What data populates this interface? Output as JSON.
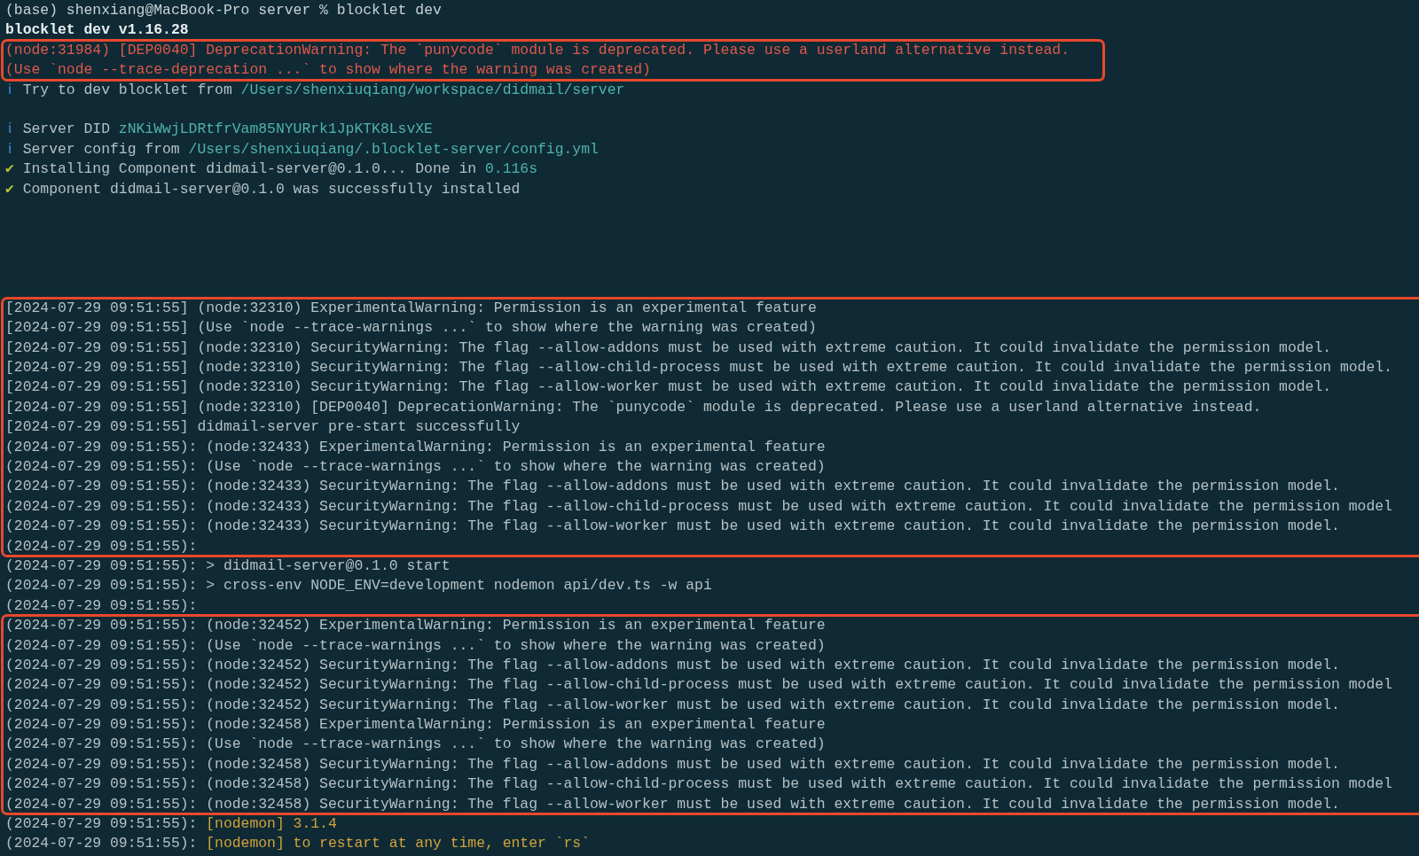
{
  "blocks": [
    {
      "highlighted": false,
      "lines": [
        {
          "kind": "text",
          "segments": [
            {
              "text": "(base) shenxiang@MacBook-Pro server % blocklet dev",
              "kind": "prompt"
            }
          ]
        },
        {
          "kind": "text",
          "segments": [
            {
              "text": "blocklet dev v1.16.28",
              "kind": "bold"
            }
          ]
        }
      ]
    },
    {
      "highlighted": true,
      "lines": [
        {
          "kind": "text",
          "segments": [
            {
              "text": "(node:31984) [DEP0040] DeprecationWarning: The `punycode` module is deprecated. Please use a userland alternative instead.",
              "kind": "error"
            }
          ]
        },
        {
          "kind": "text",
          "segments": [
            {
              "text": "(Use `node --trace-deprecation ...` to show where the warning was created)",
              "kind": "error"
            }
          ]
        }
      ]
    },
    {
      "highlighted": false,
      "lines": [
        {
          "kind": "text",
          "icon": {
            "kind": "info",
            "text": "ℹ"
          },
          "segments": [
            {
              "text": "Try to dev blocklet from ",
              "kind": "plain"
            },
            {
              "text": "/Users/shenxiuqiang/workspace/didmail/server",
              "kind": "accent"
            }
          ]
        },
        {
          "kind": "blank"
        },
        {
          "kind": "text",
          "icon": {
            "kind": "info",
            "text": "ℹ"
          },
          "segments": [
            {
              "text": "Server DID ",
              "kind": "plain"
            },
            {
              "text": "zNKiWwjLDRtfrVam85NYURrk1JpKTK8LsvXE",
              "kind": "accent"
            }
          ]
        },
        {
          "kind": "text",
          "icon": {
            "kind": "info",
            "text": "ℹ"
          },
          "segments": [
            {
              "text": "Server config from ",
              "kind": "plain"
            },
            {
              "text": "/Users/shenxiuqiang/.blocklet-server/config.yml",
              "kind": "accent"
            }
          ]
        },
        {
          "kind": "text",
          "icon": {
            "kind": "check",
            "text": "✔"
          },
          "segments": [
            {
              "text": "Installing Component didmail-server@0.1.0... Done in ",
              "kind": "plain"
            },
            {
              "text": "0.116s",
              "kind": "accent"
            }
          ]
        },
        {
          "kind": "text",
          "icon": {
            "kind": "check",
            "text": "✔"
          },
          "segments": [
            {
              "text": "Component didmail-server@0.1.0 was successfully installed",
              "kind": "plain"
            }
          ]
        },
        {
          "kind": "blank"
        },
        {
          "kind": "blank"
        },
        {
          "kind": "blank"
        },
        {
          "kind": "blank"
        },
        {
          "kind": "blank"
        }
      ]
    },
    {
      "highlighted": true,
      "lines": [
        {
          "kind": "text",
          "segments": [
            {
              "text": "[2024-07-29 09:51:55] (node:32310) ExperimentalWarning: Permission is an experimental feature",
              "kind": "plain"
            }
          ]
        },
        {
          "kind": "text",
          "segments": [
            {
              "text": "[2024-07-29 09:51:55] (Use `node --trace-warnings ...` to show where the warning was created)",
              "kind": "plain"
            }
          ]
        },
        {
          "kind": "text",
          "segments": [
            {
              "text": "[2024-07-29 09:51:55] (node:32310) SecurityWarning: The flag --allow-addons must be used with extreme caution. It could invalidate the permission model.",
              "kind": "plain"
            }
          ]
        },
        {
          "kind": "text",
          "segments": [
            {
              "text": "[2024-07-29 09:51:55] (node:32310) SecurityWarning: The flag --allow-child-process must be used with extreme caution. It could invalidate the permission model.",
              "kind": "plain"
            }
          ]
        },
        {
          "kind": "text",
          "segments": [
            {
              "text": "[2024-07-29 09:51:55] (node:32310) SecurityWarning: The flag --allow-worker must be used with extreme caution. It could invalidate the permission model.",
              "kind": "plain"
            }
          ]
        },
        {
          "kind": "text",
          "segments": [
            {
              "text": "[2024-07-29 09:51:55] (node:32310) [DEP0040] DeprecationWarning: The `punycode` module is deprecated. Please use a userland alternative instead.",
              "kind": "plain"
            }
          ]
        },
        {
          "kind": "text",
          "segments": [
            {
              "text": "[2024-07-29 09:51:55] didmail-server pre-start successfully",
              "kind": "plain"
            }
          ]
        },
        {
          "kind": "text",
          "segments": [
            {
              "text": "(2024-07-29 09:51:55): (node:32433) ExperimentalWarning: Permission is an experimental feature",
              "kind": "plain"
            }
          ]
        },
        {
          "kind": "text",
          "segments": [
            {
              "text": "(2024-07-29 09:51:55): (Use `node --trace-warnings ...` to show where the warning was created)",
              "kind": "plain"
            }
          ]
        },
        {
          "kind": "text",
          "segments": [
            {
              "text": "(2024-07-29 09:51:55): (node:32433) SecurityWarning: The flag --allow-addons must be used with extreme caution. It could invalidate the permission model.",
              "kind": "plain"
            }
          ]
        },
        {
          "kind": "text",
          "segments": [
            {
              "text": "(2024-07-29 09:51:55): (node:32433) SecurityWarning: The flag --allow-child-process must be used with extreme caution. It could invalidate the permission model",
              "kind": "plain"
            }
          ]
        },
        {
          "kind": "text",
          "segments": [
            {
              "text": "(2024-07-29 09:51:55): (node:32433) SecurityWarning: The flag --allow-worker must be used with extreme caution. It could invalidate the permission model.",
              "kind": "plain"
            }
          ]
        },
        {
          "kind": "text",
          "segments": [
            {
              "text": "(2024-07-29 09:51:55):",
              "kind": "plain"
            }
          ]
        }
      ]
    },
    {
      "highlighted": false,
      "lines": [
        {
          "kind": "text",
          "segments": [
            {
              "text": "(2024-07-29 09:51:55): > didmail-server@0.1.0 start",
              "kind": "plain"
            }
          ]
        },
        {
          "kind": "text",
          "segments": [
            {
              "text": "(2024-07-29 09:51:55): > cross-env NODE_ENV=development nodemon api/dev.ts -w api",
              "kind": "plain"
            }
          ]
        },
        {
          "kind": "text",
          "segments": [
            {
              "text": "(2024-07-29 09:51:55):",
              "kind": "plain"
            }
          ]
        }
      ]
    },
    {
      "highlighted": true,
      "lines": [
        {
          "kind": "text",
          "segments": [
            {
              "text": "(2024-07-29 09:51:55): (node:32452) ExperimentalWarning: Permission is an experimental feature",
              "kind": "plain"
            }
          ]
        },
        {
          "kind": "text",
          "segments": [
            {
              "text": "(2024-07-29 09:51:55): (Use `node --trace-warnings ...` to show where the warning was created)",
              "kind": "plain"
            }
          ]
        },
        {
          "kind": "text",
          "segments": [
            {
              "text": "(2024-07-29 09:51:55): (node:32452) SecurityWarning: The flag --allow-addons must be used with extreme caution. It could invalidate the permission model.",
              "kind": "plain"
            }
          ]
        },
        {
          "kind": "text",
          "segments": [
            {
              "text": "(2024-07-29 09:51:55): (node:32452) SecurityWarning: The flag --allow-child-process must be used with extreme caution. It could invalidate the permission model",
              "kind": "plain"
            }
          ]
        },
        {
          "kind": "text",
          "segments": [
            {
              "text": "(2024-07-29 09:51:55): (node:32452) SecurityWarning: The flag --allow-worker must be used with extreme caution. It could invalidate the permission model.",
              "kind": "plain"
            }
          ]
        },
        {
          "kind": "text",
          "segments": [
            {
              "text": "(2024-07-29 09:51:55): (node:32458) ExperimentalWarning: Permission is an experimental feature",
              "kind": "plain"
            }
          ]
        },
        {
          "kind": "text",
          "segments": [
            {
              "text": "(2024-07-29 09:51:55): (Use `node --trace-warnings ...` to show where the warning was created)",
              "kind": "plain"
            }
          ]
        },
        {
          "kind": "text",
          "segments": [
            {
              "text": "(2024-07-29 09:51:55): (node:32458) SecurityWarning: The flag --allow-addons must be used with extreme caution. It could invalidate the permission model.",
              "kind": "plain"
            }
          ]
        },
        {
          "kind": "text",
          "segments": [
            {
              "text": "(2024-07-29 09:51:55): (node:32458) SecurityWarning: The flag --allow-child-process must be used with extreme caution. It could invalidate the permission model",
              "kind": "plain"
            }
          ]
        },
        {
          "kind": "text",
          "segments": [
            {
              "text": "(2024-07-29 09:51:55): (node:32458) SecurityWarning: The flag --allow-worker must be used with extreme caution. It could invalidate the permission model.",
              "kind": "plain"
            }
          ]
        }
      ]
    },
    {
      "highlighted": false,
      "lines": [
        {
          "kind": "text",
          "segments": [
            {
              "text": "(2024-07-29 09:51:55): ",
              "kind": "plain"
            },
            {
              "text": "[nodemon] 3.1.4",
              "kind": "nodemon"
            }
          ]
        },
        {
          "kind": "text",
          "segments": [
            {
              "text": "(2024-07-29 09:51:55): ",
              "kind": "plain"
            },
            {
              "text": "[nodemon] to restart at any time, enter `rs`",
              "kind": "nodemon"
            }
          ]
        }
      ]
    }
  ]
}
